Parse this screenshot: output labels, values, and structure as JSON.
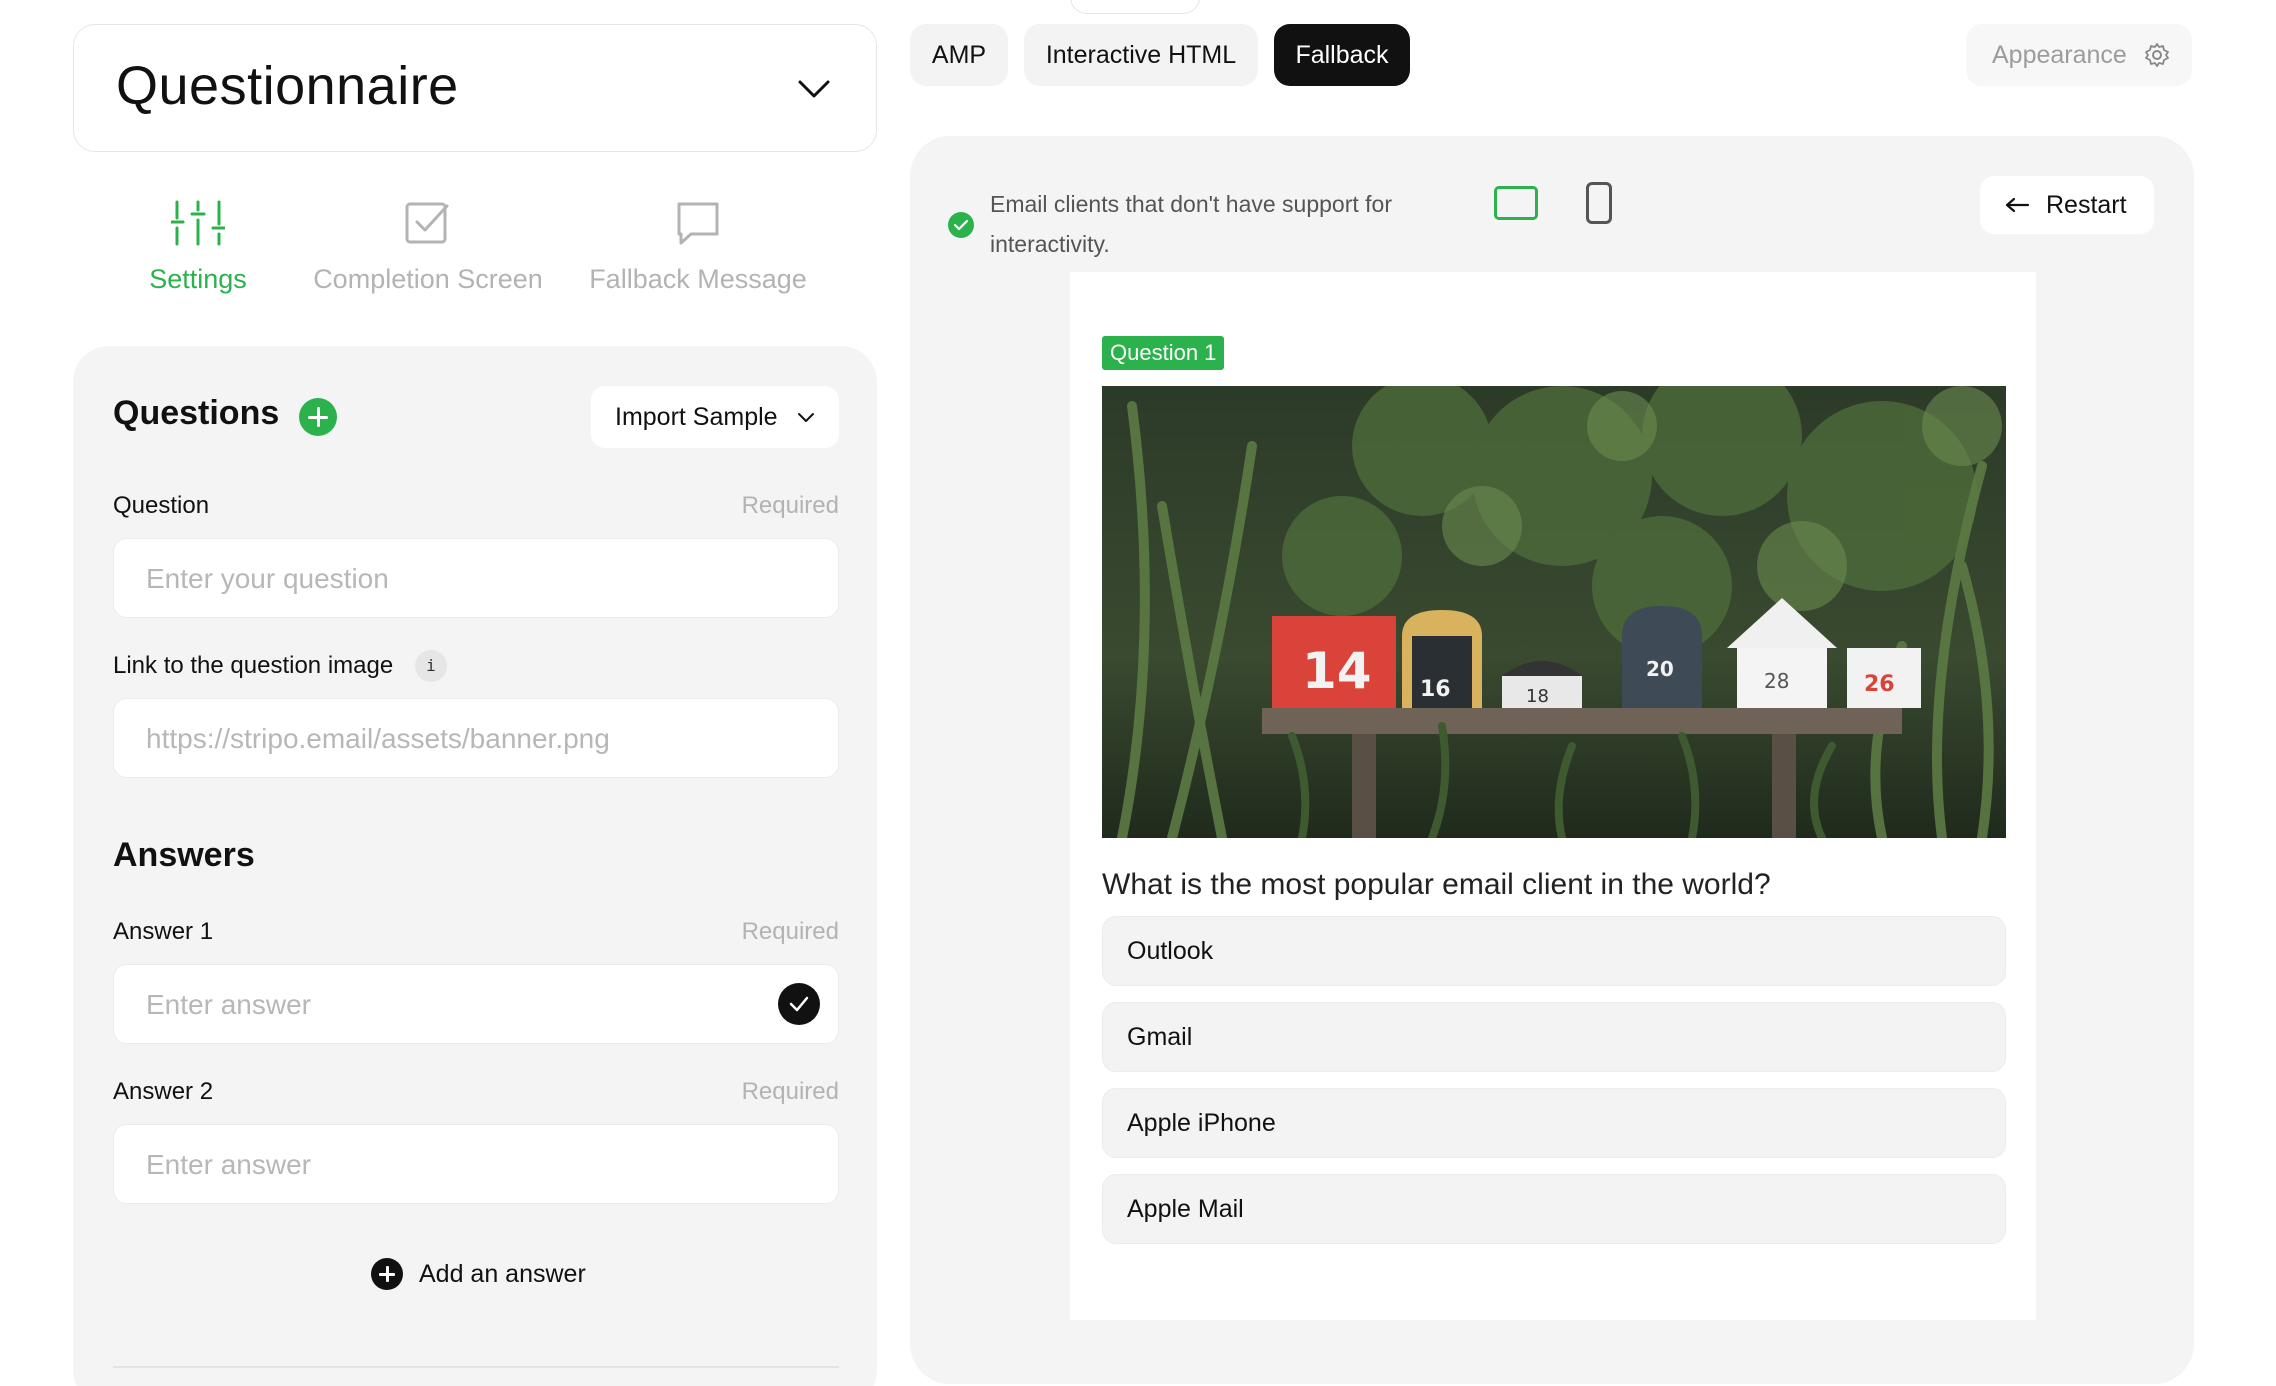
{
  "widget": {
    "title": "Questionnaire"
  },
  "tabs": [
    {
      "label": "Settings",
      "icon": "sliders-icon",
      "active": true
    },
    {
      "label": "Completion Screen",
      "icon": "checkbox-icon",
      "active": false
    },
    {
      "label": "Fallback Message",
      "icon": "message-icon",
      "active": false
    }
  ],
  "questions": {
    "heading": "Questions",
    "import_label": "Import Sample",
    "question_label": "Question",
    "required": "Required",
    "question_placeholder": "Enter your question",
    "image_label": "Link to the question image",
    "info_glyph": "i",
    "image_placeholder": "https://stripo.email/assets/banner.png",
    "answers_heading": "Answers",
    "answers": [
      {
        "label": "Answer 1",
        "placeholder": "Enter answer",
        "correct": true
      },
      {
        "label": "Answer 2",
        "placeholder": "Enter answer",
        "correct": false
      }
    ],
    "add_answer": "Add an answer"
  },
  "modes": [
    {
      "label": "AMP",
      "active": false
    },
    {
      "label": "Interactive HTML",
      "active": false
    },
    {
      "label": "Fallback",
      "active": true
    }
  ],
  "appearance": "Appearance",
  "preview": {
    "notice": "Email clients that don't have support for interactivity.",
    "restart": "Restart",
    "badge": "Question 1",
    "question": "What is the most popular email client in the world?",
    "options": [
      "Outlook",
      "Gmail",
      "Apple iPhone",
      "Apple Mail"
    ],
    "mailbox_numbers": [
      "14",
      "16",
      "18",
      "20",
      "28",
      "26"
    ]
  },
  "colors": {
    "accent": "#2bb24c",
    "dark": "#111111",
    "panel": "#f4f4f4",
    "muted": "#b3b3b3"
  }
}
